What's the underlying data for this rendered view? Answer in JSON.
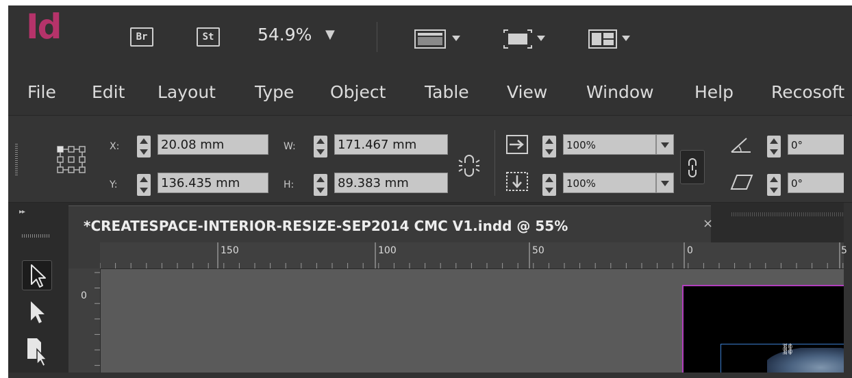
{
  "app": {
    "logo": "Id",
    "bridge_label": "Br",
    "stock_label": "St",
    "zoom": "54.9%"
  },
  "menu": [
    "File",
    "Edit",
    "Layout",
    "Type",
    "Object",
    "Table",
    "View",
    "Window",
    "Help",
    "Recosoft"
  ],
  "control": {
    "x_label": "X:",
    "x_value": "20.08 mm",
    "y_label": "Y:",
    "y_value": "136.435 mm",
    "w_label": "W:",
    "w_value": "171.467 mm",
    "h_label": "H:",
    "h_value": "89.383 mm",
    "scale_x": "100%",
    "scale_y": "100%",
    "rotation": "0°",
    "shear": "0°"
  },
  "document": {
    "tab_title": "*CREATESPACE-INTERIOR-RESIZE-SEP2014 CMC V1.indd @ 55%",
    "close": "×"
  },
  "ruler": {
    "h_labels": [
      "150",
      "100",
      "50",
      "0",
      "5"
    ],
    "v_labels": [
      "0"
    ]
  },
  "colors": {
    "accent": "#b5336a",
    "frame": "#b13fbd",
    "selection": "#3d7fd0"
  }
}
